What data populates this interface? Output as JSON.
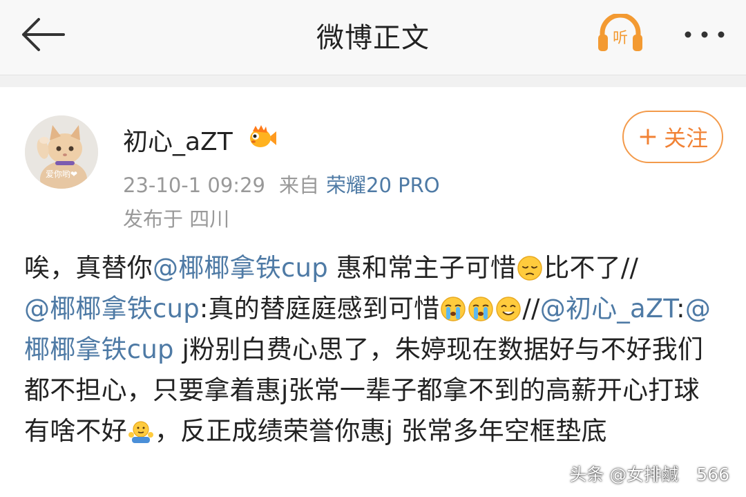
{
  "nav": {
    "title": "微博正文",
    "listen_label": "听"
  },
  "post": {
    "author": {
      "name": "初心_aZT",
      "avatar_caption": "爱你哟❤"
    },
    "follow_label": "关注",
    "time": "23-10-1 09:29",
    "via_label": "来自",
    "device": "荣耀20 PRO",
    "location": "发布于 四川",
    "content": {
      "p1": "唉，真替你",
      "m1": "@椰椰拿铁cup",
      "p2": " 惠和常主子可惜",
      "p3": "比不了//",
      "m2": "@椰椰拿铁cup",
      "p4": ":真的替庭庭感到可惜",
      "p5": "//",
      "m3": "@初心_aZT",
      "p6": ":",
      "m4": "@椰椰拿铁cup",
      "p7": " j粉别白费心思了，朱婷现在数据好与不好我们都不担心，只要拿着惠j张常一辈子都拿不到的高薪开心打球有啥不好",
      "p8": "，反正成绩荣誉你惠j 张常多年空框垫底"
    }
  },
  "watermark": {
    "text": "头条 @女排鹹",
    "count": "566"
  },
  "colors": {
    "accent": "#f18235",
    "link": "#4e7aa5",
    "text": "#222222",
    "meta": "#999999"
  },
  "icons": [
    "back-arrow-icon",
    "listen-headphone-icon",
    "more-dots-icon",
    "fish-badge-icon",
    "pensive-emoji",
    "crying-emoji",
    "smiling-emoji",
    "shrug-emoji"
  ]
}
